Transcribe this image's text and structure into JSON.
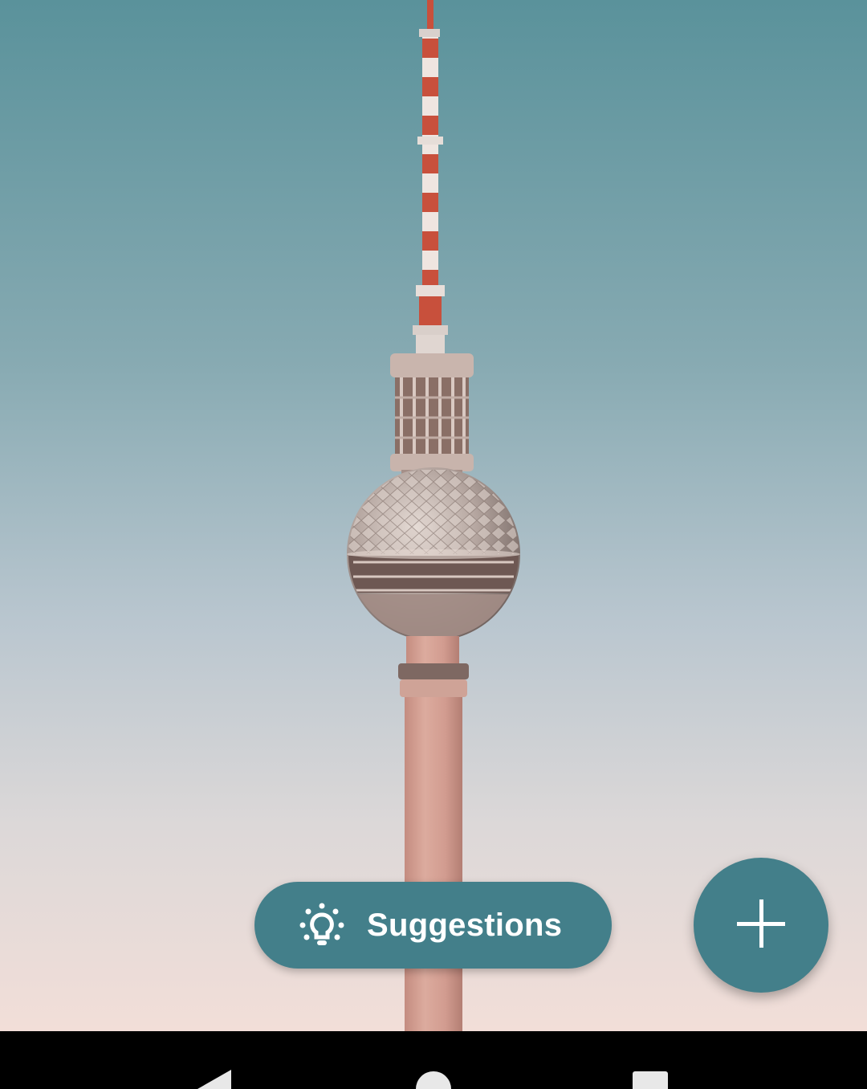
{
  "suggestions": {
    "label": "Suggestions",
    "icon": "lightbulb-icon"
  },
  "fab": {
    "icon": "plus-icon"
  },
  "nav": {
    "back_icon": "back-triangle-icon",
    "home_icon": "home-circle-icon",
    "recents_icon": "recents-square-icon"
  },
  "colors": {
    "accent": "#437f8a",
    "sky_top": "#5c949c",
    "sky_mid": "#a9bfc8",
    "sky_bottom": "#f0dcd6"
  }
}
